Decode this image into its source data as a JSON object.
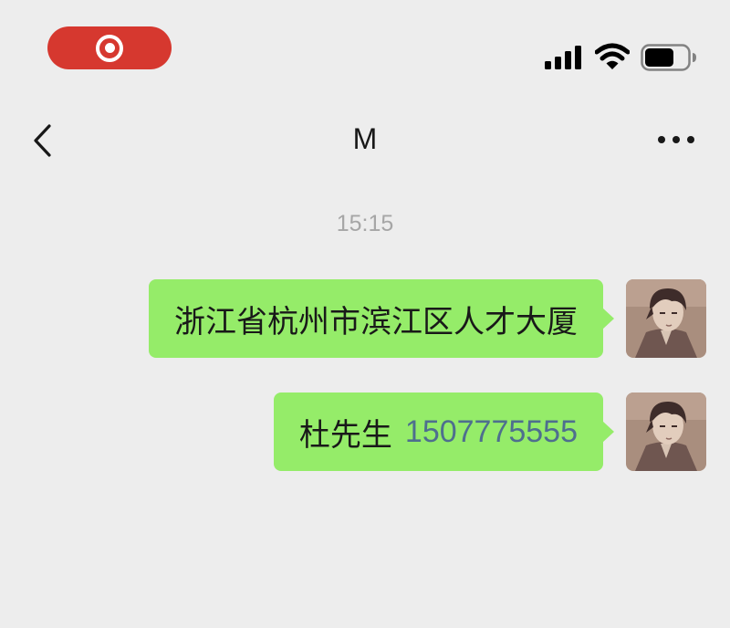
{
  "status_bar": {
    "recording_icon": "screen-record-icon",
    "signal_icon": "cellular-signal-icon",
    "wifi_icon": "wifi-icon",
    "battery_icon": "battery-icon",
    "record_color": "#d6382f"
  },
  "header": {
    "back_icon": "chevron-left-icon",
    "title": "M",
    "more_icon": "more-dots-icon"
  },
  "chat": {
    "timestamp": "15:15",
    "bubble_color": "#95ec69",
    "messages": [
      {
        "sender": "self",
        "text": "浙江省杭州市滨江区人才大厦"
      },
      {
        "sender": "self",
        "text": "杜先生",
        "phone": "1507775555"
      }
    ]
  },
  "colors": {
    "background": "#ededed",
    "link": "#4e6f8e",
    "timestamp": "#a6a6a6"
  }
}
